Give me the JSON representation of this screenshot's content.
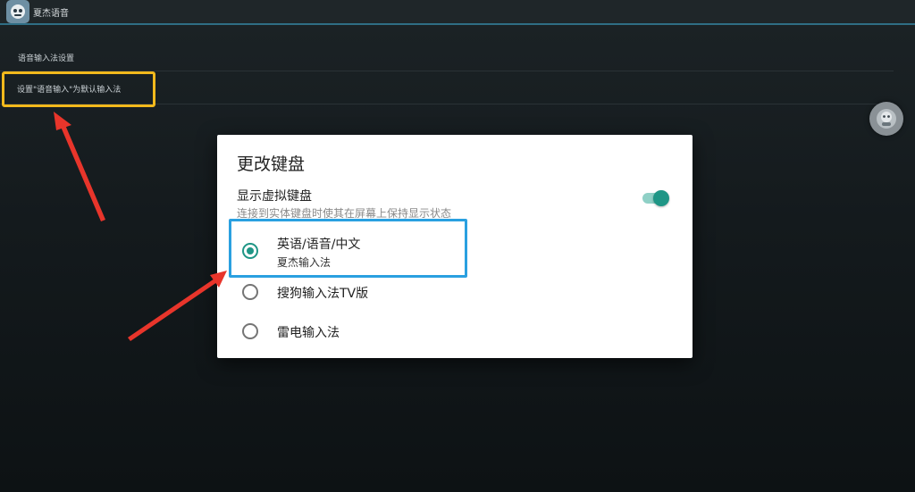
{
  "app": {
    "title": "夏杰语音",
    "icon": "app-logo-icon"
  },
  "settings": {
    "items": [
      {
        "label": "语音输入法设置"
      },
      {
        "label": "设置\"语音输入\"为默认输入法"
      }
    ]
  },
  "floating_ball": {
    "icon": "assistant-ball-icon"
  },
  "dialog": {
    "title": "更改键盘",
    "virtual_keyboard": {
      "label": "显示虚拟键盘",
      "description": "连接到实体键盘时使其在屏幕上保持显示状态",
      "enabled": true
    },
    "options": [
      {
        "label": "英语/语音/中文",
        "sublabel": "夏杰输入法",
        "selected": true
      },
      {
        "label": "搜狗输入法TV版",
        "selected": false
      },
      {
        "label": "雷电输入法",
        "selected": false
      }
    ]
  },
  "colors": {
    "accent": "#1f9686",
    "highlight_yellow": "#f2b91c",
    "highlight_blue": "#2aa0e0",
    "arrow": "#e8352b"
  }
}
